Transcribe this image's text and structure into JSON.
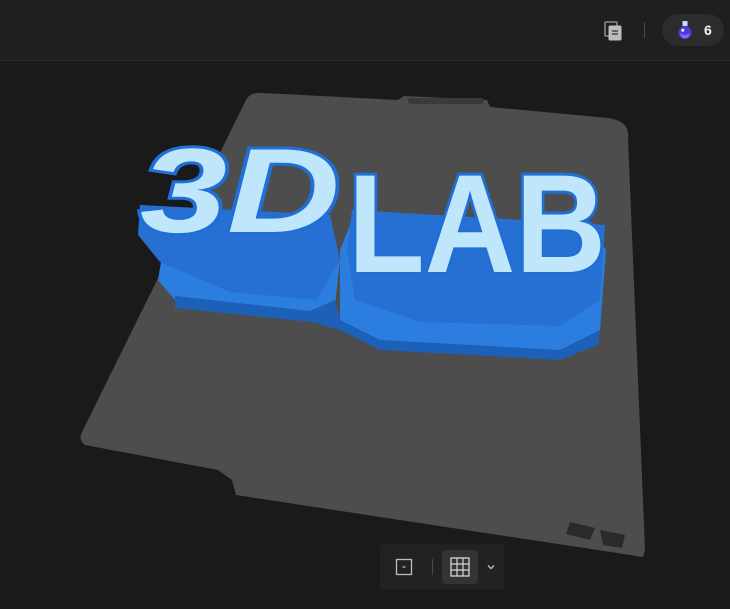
{
  "header": {
    "copy_icon": "copy-document-icon",
    "credits": {
      "icon": "potion-flask-icon",
      "count": "6"
    }
  },
  "viewport": {
    "model_text": [
      "3D",
      "LAB"
    ],
    "colors": {
      "background": "#1a1a1a",
      "build_plate": "#4d4d4d",
      "model_base": "#2b7de0",
      "letter_face": "#bfe6fb",
      "letter_outline": "#1f6fd6"
    }
  },
  "toolbar": {
    "view_button_icon": "single-view-icon",
    "grid_button_icon": "grid-icon",
    "dropdown_icon": "chevron-down-icon"
  }
}
